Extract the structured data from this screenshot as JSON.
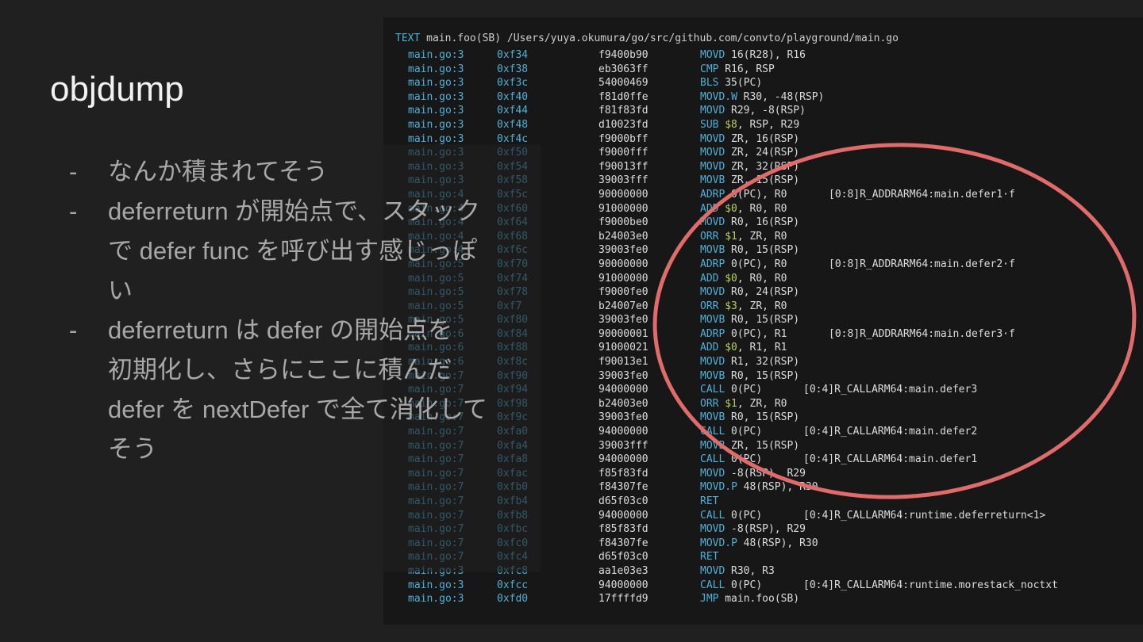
{
  "title": "objdump",
  "bullets": [
    {
      "dash": "-",
      "text": "なんか積まれてそう"
    },
    {
      "dash": "-",
      "text": "deferreturn が開始点で、スタック\nで defer func を呼び出す感じっぽ\nい"
    },
    {
      "dash": "-",
      "text": "deferreturn は defer の開始点を\n初期化し、さらにここに積んだ\ndefer を nextDefer で全て消化して\nそう"
    }
  ],
  "dump": {
    "header_kw": "TEXT",
    "header_rest": " main.foo(SB) /Users/yuya.okumura/go/src/github.com/convto/playground/main.go",
    "rows": [
      {
        "file": "main.go:3",
        "addr": "0xf34",
        "hex": "f9400b90",
        "op": "MOVD",
        "args": " 16(R28), R16",
        "reloc": ""
      },
      {
        "file": "main.go:3",
        "addr": "0xf38",
        "hex": "eb3063ff",
        "op": "CMP",
        "args": " R16, RSP",
        "reloc": ""
      },
      {
        "file": "main.go:3",
        "addr": "0xf3c",
        "hex": "54000469",
        "op": "BLS",
        "args": " 35(PC)",
        "reloc": ""
      },
      {
        "file": "main.go:3",
        "addr": "0xf40",
        "hex": "f81d0ffe",
        "op": "MOVD.W",
        "args": " R30, -48(RSP)",
        "reloc": ""
      },
      {
        "file": "main.go:3",
        "addr": "0xf44",
        "hex": "f81f83fd",
        "op": "MOVD",
        "args": " R29, -8(RSP)",
        "reloc": ""
      },
      {
        "file": "main.go:3",
        "addr": "0xf48",
        "hex": "d10023fd",
        "op": "SUB",
        "args": " $8, RSP, R29",
        "reloc": ""
      },
      {
        "file": "main.go:3",
        "addr": "0xf4c",
        "hex": "f9000bff",
        "op": "MOVD",
        "args": " ZR, 16(RSP)",
        "reloc": ""
      },
      {
        "file": "main.go:3",
        "addr": "0xf50",
        "hex": "f9000fff",
        "op": "MOVD",
        "args": " ZR, 24(RSP)",
        "reloc": ""
      },
      {
        "file": "main.go:3",
        "addr": "0xf54",
        "hex": "f90013ff",
        "op": "MOVD",
        "args": " ZR, 32(RSP)",
        "reloc": ""
      },
      {
        "file": "main.go:3",
        "addr": "0xf58",
        "hex": "39003fff",
        "op": "MOVB",
        "args": " ZR, 15(RSP)",
        "reloc": ""
      },
      {
        "file": "main.go:4",
        "addr": "0xf5c",
        "hex": "90000000",
        "op": "ADRP",
        "args": " 0(PC), R0",
        "reloc": "[0:8]R_ADDRARM64:main.defer1·f"
      },
      {
        "file": "main.go:4",
        "addr": "0xf60",
        "hex": "91000000",
        "op": "ADD",
        "args": " $0, R0, R0",
        "reloc": ""
      },
      {
        "file": "main.go:4",
        "addr": "0xf64",
        "hex": "f9000be0",
        "op": "MOVD",
        "args": " R0, 16(RSP)",
        "reloc": ""
      },
      {
        "file": "main.go:4",
        "addr": "0xf68",
        "hex": "b24003e0",
        "op": "ORR",
        "args": " $1, ZR, R0",
        "reloc": ""
      },
      {
        "file": "main.go:4",
        "addr": "0xf6c",
        "hex": "39003fe0",
        "op": "MOVB",
        "args": " R0, 15(RSP)",
        "reloc": ""
      },
      {
        "file": "main.go:5",
        "addr": "0xf70",
        "hex": "90000000",
        "op": "ADRP",
        "args": " 0(PC), R0",
        "reloc": "[0:8]R_ADDRARM64:main.defer2·f"
      },
      {
        "file": "main.go:5",
        "addr": "0xf74",
        "hex": "91000000",
        "op": "ADD",
        "args": " $0, R0, R0",
        "reloc": ""
      },
      {
        "file": "main.go:5",
        "addr": "0xf78",
        "hex": "f9000fe0",
        "op": "MOVD",
        "args": " R0, 24(RSP)",
        "reloc": ""
      },
      {
        "file": "main.go:5",
        "addr": "0xf7",
        "hex": "b24007e0",
        "op": "ORR",
        "args": " $3, ZR, R0",
        "reloc": ""
      },
      {
        "file": "main.go:5",
        "addr": "0xf80",
        "hex": "39003fe0",
        "op": "MOVB",
        "args": " R0, 15(RSP)",
        "reloc": ""
      },
      {
        "file": "main.go:6",
        "addr": "0xf84",
        "hex": "90000001",
        "op": "ADRP",
        "args": " 0(PC), R1",
        "reloc": "[0:8]R_ADDRARM64:main.defer3·f"
      },
      {
        "file": "main.go:6",
        "addr": "0xf88",
        "hex": "91000021",
        "op": "ADD",
        "args": " $0, R1, R1",
        "reloc": ""
      },
      {
        "file": "main.go:6",
        "addr": "0xf8c",
        "hex": "f90013e1",
        "op": "MOVD",
        "args": " R1, 32(RSP)",
        "reloc": ""
      },
      {
        "file": "main.go:7",
        "addr": "0xf90",
        "hex": "39003fe0",
        "op": "MOVB",
        "args": " R0, 15(RSP)",
        "reloc": ""
      },
      {
        "file": "main.go:7",
        "addr": "0xf94",
        "hex": "94000000",
        "op": "CALL",
        "args": " 0(PC)",
        "reloc": "[0:4]R_CALLARM64:main.defer3"
      },
      {
        "file": "main.go:7",
        "addr": "0xf98",
        "hex": "b24003e0",
        "op": "ORR",
        "args": " $1, ZR, R0",
        "reloc": ""
      },
      {
        "file": "main.go:7",
        "addr": "0xf9c",
        "hex": "39003fe0",
        "op": "MOVB",
        "args": " R0, 15(RSP)",
        "reloc": ""
      },
      {
        "file": "main.go:7",
        "addr": "0xfa0",
        "hex": "94000000",
        "op": "CALL",
        "args": " 0(PC)",
        "reloc": "[0:4]R_CALLARM64:main.defer2"
      },
      {
        "file": "main.go:7",
        "addr": "0xfa4",
        "hex": "39003fff",
        "op": "MOVB",
        "args": " ZR, 15(RSP)",
        "reloc": ""
      },
      {
        "file": "main.go:7",
        "addr": "0xfa8",
        "hex": "94000000",
        "op": "CALL",
        "args": " 0(PC)",
        "reloc": "[0:4]R_CALLARM64:main.defer1"
      },
      {
        "file": "main.go:7",
        "addr": "0xfac",
        "hex": "f85f83fd",
        "op": "MOVD",
        "args": " -8(RSP), R29",
        "reloc": ""
      },
      {
        "file": "main.go:7",
        "addr": "0xfb0",
        "hex": "f84307fe",
        "op": "MOVD.P",
        "args": " 48(RSP), R30",
        "reloc": ""
      },
      {
        "file": "main.go:7",
        "addr": "0xfb4",
        "hex": "d65f03c0",
        "op": "RET",
        "args": "",
        "reloc": ""
      },
      {
        "file": "main.go:7",
        "addr": "0xfb8",
        "hex": "94000000",
        "op": "CALL",
        "args": " 0(PC)",
        "reloc": "[0:4]R_CALLARM64:runtime.deferreturn<1>"
      },
      {
        "file": "main.go:7",
        "addr": "0xfbc",
        "hex": "f85f83fd",
        "op": "MOVD",
        "args": " -8(RSP), R29",
        "reloc": ""
      },
      {
        "file": "main.go:7",
        "addr": "0xfc0",
        "hex": "f84307fe",
        "op": "MOVD.P",
        "args": " 48(RSP), R30",
        "reloc": ""
      },
      {
        "file": "main.go:7",
        "addr": "0xfc4",
        "hex": "d65f03c0",
        "op": "RET",
        "args": "",
        "reloc": ""
      },
      {
        "file": "main.go:3",
        "addr": "0xfc8",
        "hex": "aa1e03e3",
        "op": "MOVD",
        "args": " R30, R3",
        "reloc": ""
      },
      {
        "file": "main.go:3",
        "addr": "0xfcc",
        "hex": "94000000",
        "op": "CALL",
        "args": " 0(PC)",
        "reloc": "[0:4]R_CALLARM64:runtime.morestack_noctxt"
      },
      {
        "file": "main.go:3",
        "addr": "0xfd0",
        "hex": "17ffffd9",
        "op": "JMP",
        "args": " main.foo(SB)",
        "reloc": ""
      }
    ]
  },
  "colors": {
    "annotation": "#e06b6b"
  }
}
